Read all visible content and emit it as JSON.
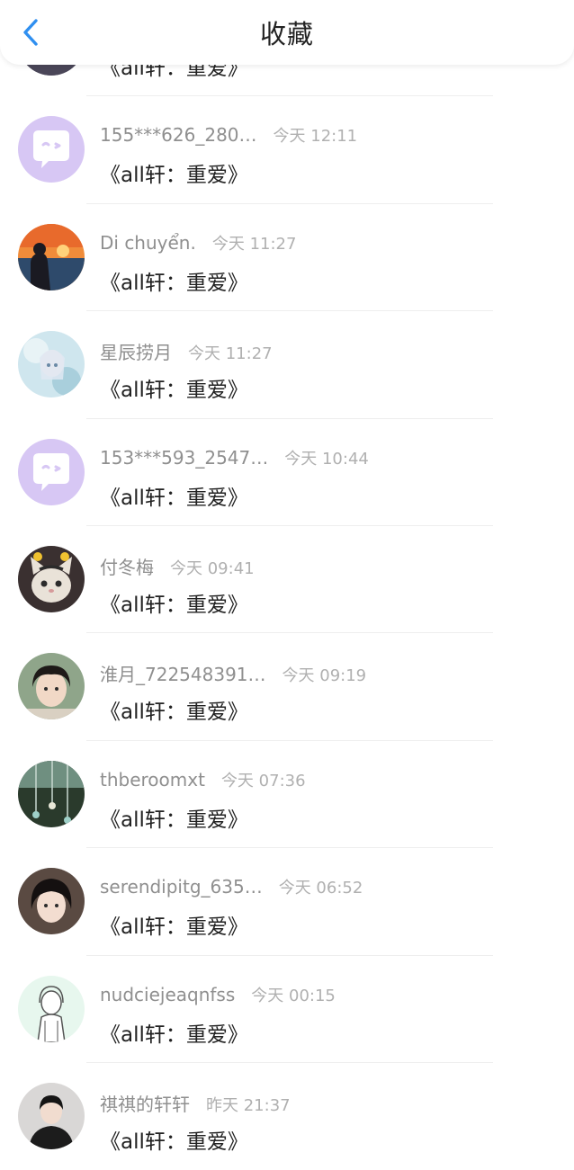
{
  "header": {
    "title": "收藏",
    "back_icon": "chevron-left-icon",
    "accent_color": "#2f8ff0"
  },
  "items": [
    {
      "username": "……",
      "time": "",
      "content": "《all轩：重爱》",
      "avatar": "photo-avatar"
    },
    {
      "username": "155***626_280…",
      "time": "今天 12:11",
      "content": "《all轩：重爱》",
      "avatar": "chat-bubble-avatar"
    },
    {
      "username": "Di chuyển.",
      "time": "今天 11:27",
      "content": "《all轩：重爱》",
      "avatar": "sunset-photo-avatar"
    },
    {
      "username": "星辰捞月",
      "time": "今天 11:27",
      "content": "《all轩：重爱》",
      "avatar": "anime-girl-avatar"
    },
    {
      "username": "153***593_2547…",
      "time": "今天 10:44",
      "content": "《all轩：重爱》",
      "avatar": "chat-bubble-avatar"
    },
    {
      "username": "付冬梅",
      "time": "今天 09:41",
      "content": "《all轩：重爱》",
      "avatar": "cat-avatar"
    },
    {
      "username": "淮月_722548391…",
      "time": "今天 09:19",
      "content": "《all轩：重爱》",
      "avatar": "person-avatar"
    },
    {
      "username": "thberoomxt",
      "time": "今天 07:36",
      "content": "《all轩：重爱》",
      "avatar": "windchime-photo-avatar"
    },
    {
      "username": "serendipitg_635…",
      "time": "今天 06:52",
      "content": "《all轩：重爱》",
      "avatar": "person-avatar"
    },
    {
      "username": "nudciejeaqnfss",
      "time": "今天 00:15",
      "content": "《all轩：重爱》",
      "avatar": "sketch-avatar"
    },
    {
      "username": "祺祺的轩轩",
      "time": "昨天 21:37",
      "content": "《all轩：重爱》",
      "avatar": "person-avatar"
    }
  ]
}
